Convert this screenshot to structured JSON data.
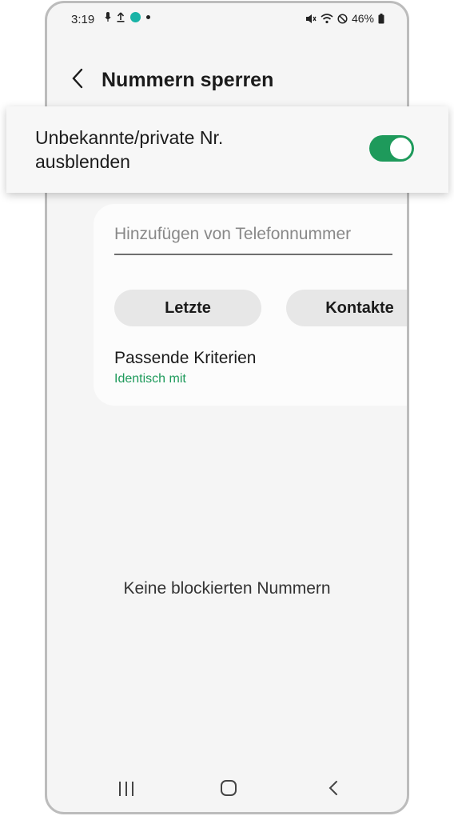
{
  "status_bar": {
    "time": "3:19",
    "battery": "46%",
    "icons": [
      "mic-icon",
      "upload-icon",
      "app-notification-icon",
      "dot-icon",
      "mute-icon",
      "wifi-icon",
      "do-not-disturb-icon",
      "battery-icon"
    ]
  },
  "header": {
    "title": "Nummern sperren"
  },
  "toggle": {
    "label": "Unbekannte/private Nr. ausblenden",
    "state": "on",
    "color": "#1e9a5b"
  },
  "add_number": {
    "placeholder": "Hinzufügen von Telefonnummer",
    "value": ""
  },
  "buttons": {
    "recent": "Letzte",
    "contacts": "Kontakte"
  },
  "criteria": {
    "title": "Passende Kriterien",
    "value": "Identisch mit"
  },
  "empty_text": "Keine blockierten Nummern",
  "colors": {
    "accent": "#1e9a5b",
    "plus": "#3cb36e"
  }
}
